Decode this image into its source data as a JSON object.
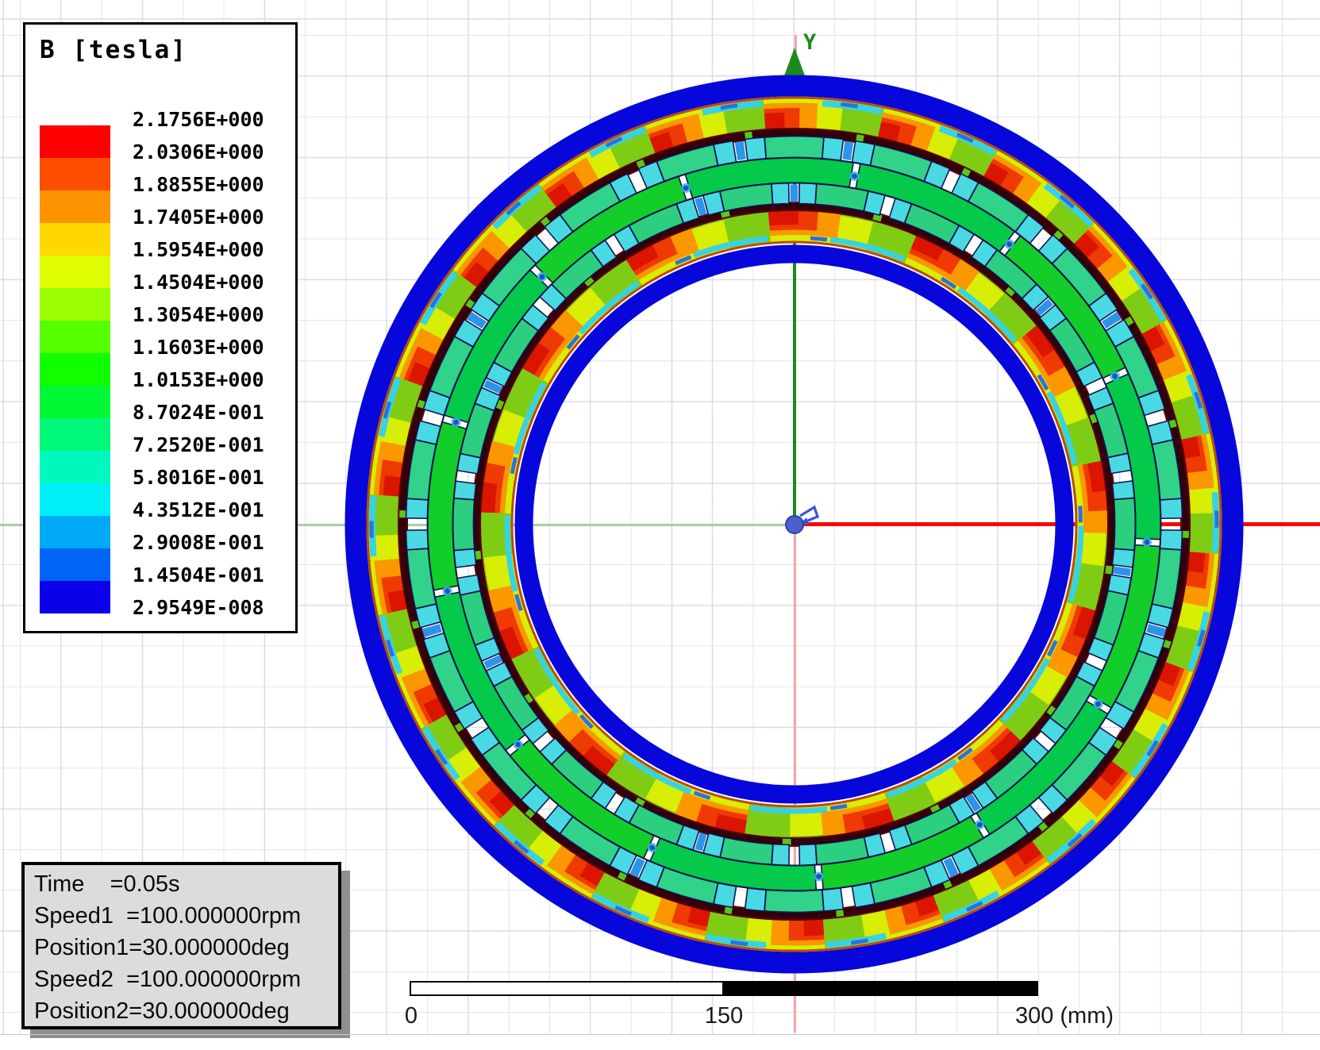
{
  "legend": {
    "title": "B [tesla]",
    "values": [
      "2.1756E+000",
      "2.0306E+000",
      "1.8855E+000",
      "1.7405E+000",
      "1.5954E+000",
      "1.4504E+000",
      "1.3054E+000",
      "1.1603E+000",
      "1.0153E+000",
      "8.7024E-001",
      "7.2520E-001",
      "5.8016E-001",
      "4.3512E-001",
      "2.9008E-001",
      "1.4504E-001",
      "2.9549E-008"
    ],
    "band_colors": [
      "#fe0000",
      "#fe4e00",
      "#fe9300",
      "#fed800",
      "#e0fe00",
      "#9bfe00",
      "#56fe00",
      "#11fe00",
      "#00f733",
      "#00f778",
      "#00f7bd",
      "#00eff7",
      "#00aaf7",
      "#0065f7",
      "#0b00e8"
    ]
  },
  "annotations": {
    "lines": [
      "Time    =0.05s",
      "Speed1  =100.000000rpm",
      "Position1=30.000000deg",
      "Speed2  =100.000000rpm",
      "Position2=30.000000deg"
    ]
  },
  "scale_bar": {
    "tick_start": "0",
    "tick_mid": "150",
    "tick_end": "300 (mm)"
  },
  "axes": {
    "y_label": "Y",
    "x_axis_color": "#f50a0a",
    "y_axis_color": "#1c8a1c",
    "neg_x_color": "#a9cfa2",
    "neg_y_color": "#f2a9a9",
    "origin_color": "#4a5fd0"
  },
  "model": {
    "colors": {
      "band_blue": "#0706db",
      "liner_ring": "#be4a08",
      "magnet_maroon": "#330009",
      "magnet_edge": "#5a000e",
      "outline_navy": "#13134f",
      "pole_teal": "#30d389",
      "pole_cap_cyan": "#49d9e2",
      "mid_green_a": "#12cd2a",
      "mid_green_b": "#04c94b",
      "gap_wedge_blue": "#2d95e9",
      "flux_dot_blue": "#2150c8",
      "yoke_base_green": "#7fcc15",
      "yoke_yellow": "#d8ee05",
      "yoke_orange": "#fb9700",
      "yoke_red": "#ef3a04",
      "yoke_deep_red": "#db1500",
      "streak_cyan": "#38d2e2",
      "streak_blue": "#2f6fe0"
    }
  },
  "chart_data": {
    "type": "heatmap",
    "title": "B [tesla]",
    "quantity": "Magnetic flux density magnitude",
    "unit": "tesla",
    "contour_levels": [
      2.1756,
      2.0306,
      1.8855,
      1.7405,
      1.5954,
      1.4504,
      1.3054,
      1.1603,
      1.0153,
      0.87024,
      0.7252,
      0.58016,
      0.43512,
      0.29008,
      0.14504,
      2.9549e-08
    ],
    "level_colors": [
      "#fe0000",
      "#fe4e00",
      "#fe9300",
      "#fed800",
      "#e0fe00",
      "#9bfe00",
      "#56fe00",
      "#11fe00",
      "#00f733",
      "#00f778",
      "#00f7bd",
      "#00eff7",
      "#00aaf7",
      "#0065f7",
      "#0b00e8"
    ],
    "annotations": {
      "time_s": 0.05,
      "speed1_rpm": 100.0,
      "position1_deg": 30.0,
      "speed2_rpm": 100.0,
      "position2_deg": 30.0
    },
    "scale_bar_mm": [
      0,
      150,
      300
    ],
    "legend_position": "top-left",
    "grid": true
  }
}
